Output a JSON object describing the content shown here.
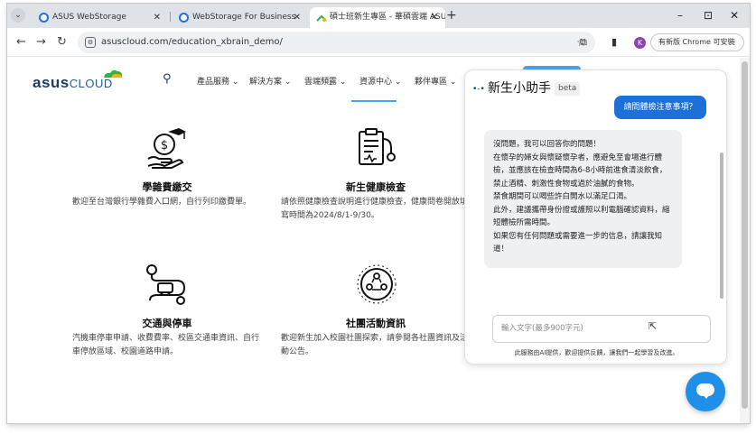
{
  "browser": {
    "tabs": [
      {
        "label": "ASUS WebStorage"
      },
      {
        "label": "WebStorage For Business"
      },
      {
        "label": "碩士班新生專區 - 華碩雲端 ASU"
      }
    ],
    "window_controls": {
      "minimize": "–",
      "restore": "⊡",
      "close": "✕"
    },
    "url": "asuscloud.com/education_xbrain_demo/",
    "profile_initial": "K",
    "update_button_label": "有新版 Chrome 可安裝"
  },
  "site": {
    "logo_text": "asus",
    "logo_text_cloud": "CLOUD",
    "nav_items": [
      "產品服務",
      "解決方案",
      "雲端頻露",
      "資源中心",
      "夥伴專區"
    ]
  },
  "features": [
    {
      "title": "學雜費繳交",
      "desc": "歡迎至台灣銀行學雜費入口網，自行列印繳費單。",
      "icon": "tuition-payment-icon"
    },
    {
      "title": "新生健康檢查",
      "desc": "請依照健康檢查說明進行健康檢查，健康問卷開放填寫時間為2024/8/1-9/30。",
      "icon": "health-checkup-icon"
    },
    {
      "title": "交通與停車",
      "desc": "汽機車停車申請、收費費率、校區交通車資訊、自行車停放區域、校園道路申請。",
      "icon": "transport-parking-icon"
    },
    {
      "title": "社團活動資訊",
      "desc": "歡迎新生加入校園社團探索，請參閱各社團資訊及活動公告。",
      "icon": "club-activity-icon"
    }
  ],
  "chat": {
    "title": "新生小助手",
    "beta": "beta",
    "user_message": "請問體檢注意事項？",
    "bot_message": [
      "沒問題，我可以回答你的問題！",
      "在懷孕的婦女與懷疑懷孕者，應避免至會場進行體檢，並應該在檢查時間為6-8小時前進食清淡飲食，禁止酒精、刺激性食物或過於油膩的食物。",
      "禁食期間可以喝些許白開水以滿足口渴。",
      "此外，建議攜帶身份證或護照以利電腦確認資料，縮短體檢所需時間。",
      "如果您有任何問題或需要進一步的信息，請讓我知道！"
    ],
    "input_placeholder": "輸入文字(最多900字元)",
    "disclaimer": "此服務由AI提供，歡迎提供反饋，讓我們一起學習及改進。"
  },
  "colors": {
    "accent": "#1d6fd9",
    "fab": "#1f8fe8",
    "brand_navy": "#1d3b63"
  }
}
